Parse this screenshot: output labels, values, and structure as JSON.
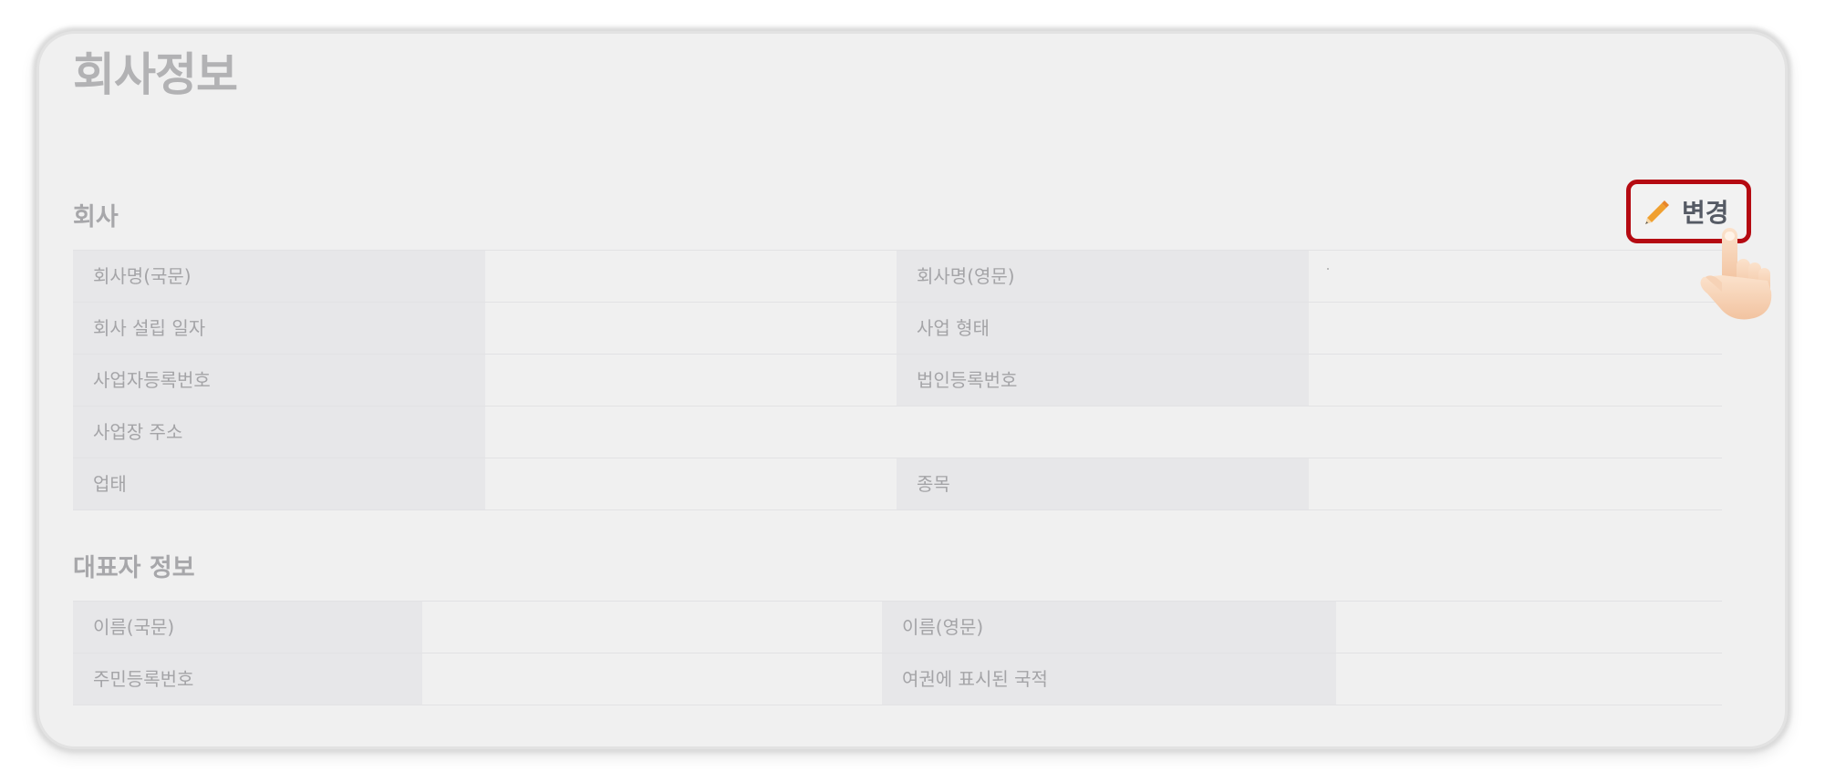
{
  "page": {
    "title": "회사정보"
  },
  "company_section": {
    "title": "회사",
    "edit_button_label": "변경",
    "rows": [
      {
        "left_label": "회사명(국문)",
        "right_label": "회사명(영문)"
      },
      {
        "left_label": "회사 설립 일자",
        "right_label": "사업 형태"
      },
      {
        "left_label": "사업자등록번호",
        "right_label": "법인등록번호"
      },
      {
        "left_label": "사업장 주소",
        "right_label": ""
      },
      {
        "left_label": "업태",
        "right_label": "종목"
      }
    ]
  },
  "representative_section": {
    "title": "대표자 정보",
    "rows": [
      {
        "left_label": "이름(국문)",
        "right_label": "이름(영문)"
      },
      {
        "left_label": "주민등록번호",
        "right_label": "여권에 표시된 국적"
      }
    ]
  },
  "icons": {
    "edit": "pencil-icon",
    "pointer": "pointing-hand-icon"
  },
  "colors": {
    "highlight_border": "#b50a12",
    "pencil": "#f0a030"
  }
}
